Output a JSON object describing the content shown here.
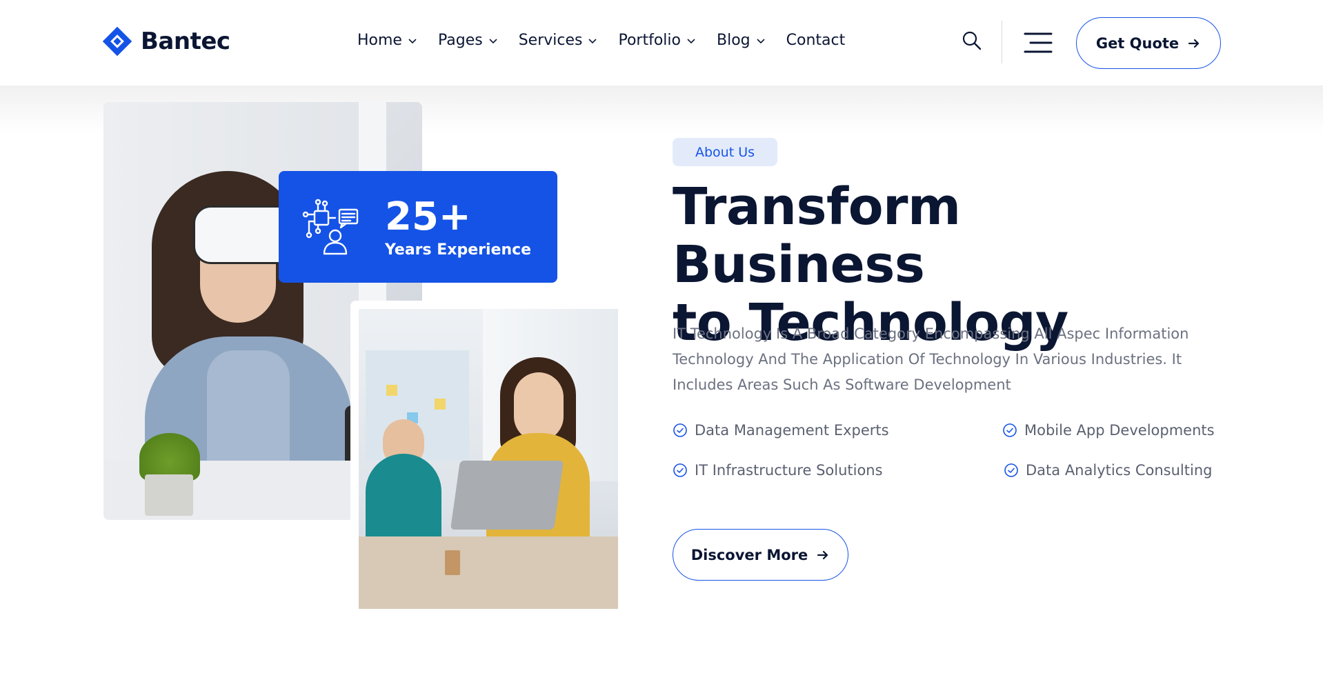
{
  "brand": {
    "name": "Bantec",
    "accent": "#1553e6",
    "dark": "#0b1633"
  },
  "nav": {
    "items": [
      {
        "label": "Home",
        "has_dropdown": true
      },
      {
        "label": "Pages",
        "has_dropdown": true
      },
      {
        "label": "Services",
        "has_dropdown": true
      },
      {
        "label": "Portfolio",
        "has_dropdown": true
      },
      {
        "label": "Blog",
        "has_dropdown": true
      },
      {
        "label": "Contact",
        "has_dropdown": false
      }
    ],
    "search_icon": "search-icon",
    "menu_icon": "hamburger-menu-icon",
    "cta_label": "Get Quote"
  },
  "experience": {
    "number": "25+",
    "label": "Years Experience",
    "icon": "tech-person-icon"
  },
  "about": {
    "badge": "About Us",
    "headline_line1": "Transform Business",
    "headline_line2": "to Technology",
    "paragraph_line1": "IT Technology Is A Broad Category Encompassing All Aspec Information",
    "paragraph_line2": "Technology And The Application Of Technology In Various Industries. It",
    "paragraph_line3": "Includes Areas Such As Software Development",
    "features": [
      "Data Management Experts",
      "Mobile App Developments",
      "IT Infrastructure Solutions",
      "Data Analytics Consulting"
    ],
    "cta_label": "Discover More"
  }
}
